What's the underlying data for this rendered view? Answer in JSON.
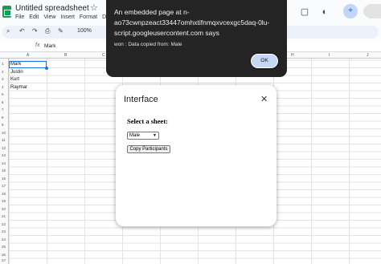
{
  "sheets": {
    "doc_title": "Untitled spreadsheet",
    "menu": [
      "File",
      "Edit",
      "View",
      "Insert",
      "Format",
      "D"
    ],
    "zoom": "100%",
    "fx": "fx",
    "formula_value": "Mark",
    "columns": [
      "A",
      "B",
      "C",
      "D",
      "E",
      "F",
      "G",
      "H",
      "I",
      "J"
    ],
    "rows": [
      "1",
      "2",
      "3",
      "4",
      "5",
      "6",
      "7",
      "8",
      "9",
      "10",
      "11",
      "12",
      "13",
      "14",
      "15",
      "16",
      "17",
      "18",
      "19",
      "20",
      "21",
      "22",
      "23",
      "24",
      "25",
      "26",
      "27"
    ],
    "cells": [
      "Mark",
      "Justin",
      "Kurt",
      "Raymar"
    ]
  },
  "alert": {
    "heading": "An embedded page at n-ao73cwnpzeact33447omhxtifnmqxvcexgc5daq-0lu-script.googleusercontent.com says",
    "message": "won : Data copied from: Male",
    "ok_label": "OK"
  },
  "modal": {
    "title": "Interface",
    "close_glyph": "✕",
    "select_label": "Select a sheet:",
    "selected_sheet": "Male",
    "copy_button": "Copy Participants"
  },
  "colors": {
    "alert_bg": "#242424",
    "ok_bg": "#c6d7f5",
    "accent": "#1a73e8",
    "sheets_green": "#0f9d58"
  }
}
